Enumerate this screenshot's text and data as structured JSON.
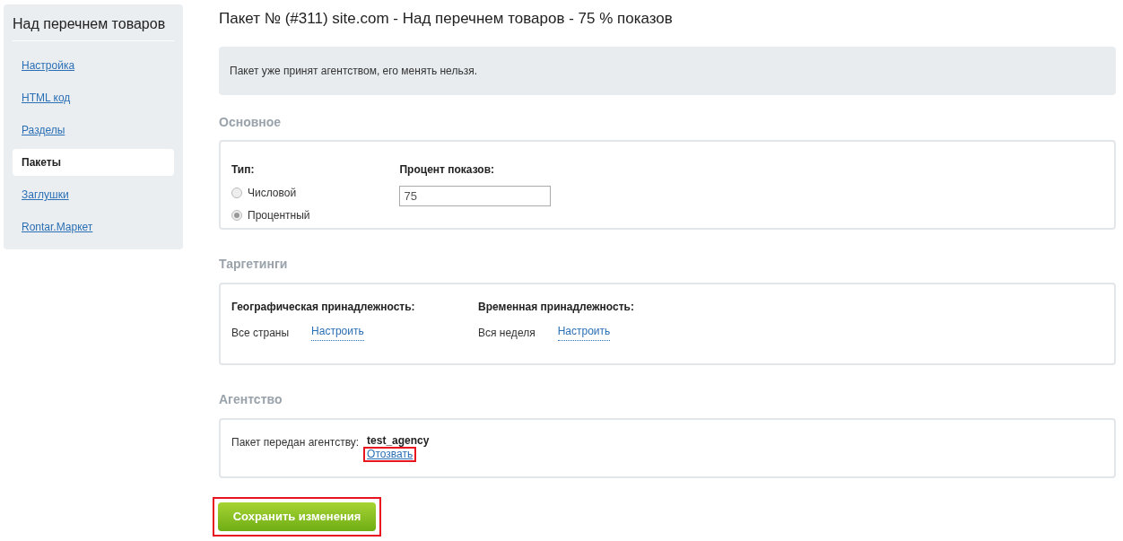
{
  "sidebar": {
    "title": "Над перечнем товаров",
    "items": [
      {
        "label": "Настройка",
        "selected": false
      },
      {
        "label": "HTML код",
        "selected": false
      },
      {
        "label": "Разделы",
        "selected": false
      },
      {
        "label": "Пакеты",
        "selected": true
      },
      {
        "label": "Заглушки",
        "selected": false
      },
      {
        "label": "Rontar.Маркет",
        "selected": false
      }
    ]
  },
  "title": "Пакет № (#311) site.com - Над перечнем товаров - 75 % показов",
  "notice": "Пакет уже принят агентством, его менять нельзя.",
  "basic": {
    "heading": "Основное",
    "type_label": "Тип:",
    "options": [
      {
        "label": "Числовой",
        "selected": false
      },
      {
        "label": "Процентный",
        "selected": true
      }
    ],
    "percent_label": "Процент показов:",
    "percent_value": "75"
  },
  "targeting": {
    "heading": "Таргетинги",
    "groups": [
      {
        "label": "Географическая принадлежность:",
        "value": "Все страны",
        "link": "Настроить"
      },
      {
        "label": "Временная принадлежность:",
        "value": "Вся неделя",
        "link": "Настроить"
      }
    ]
  },
  "agency": {
    "heading": "Агентство",
    "label": "Пакет передан агентству:",
    "name": "test_agency",
    "revoke": "Отозвать"
  },
  "save_button": "Сохранить изменения"
}
